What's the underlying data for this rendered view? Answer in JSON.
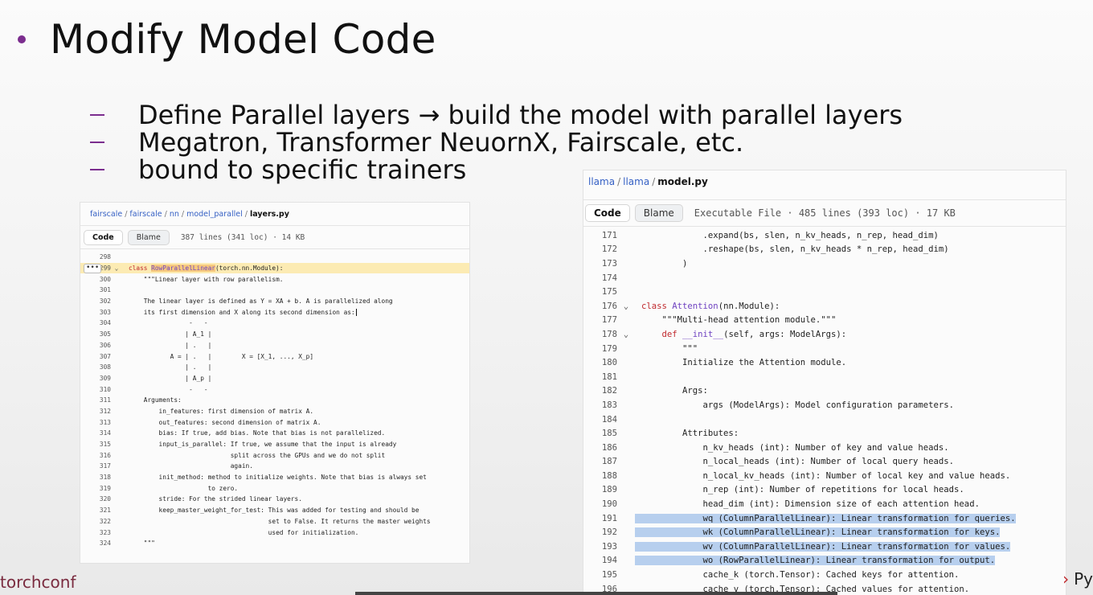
{
  "slide": {
    "title": "Modify Model Code",
    "bullets": [
      "Define Parallel layers → build the model with parallel layers",
      "Megatron, Transformer NeuornX, Fairscale, etc.",
      "bound to specific trainers"
    ],
    "footer_brand": "torchconf",
    "footer_right": "Py",
    "colors": {
      "accent": "#7b2d8e",
      "highlight": "#fcebb3",
      "selection": "#b7cfee"
    }
  },
  "left_panel": {
    "path": [
      "fairscale",
      "fairscale",
      "nn",
      "model_parallel"
    ],
    "file": "layers.py",
    "tabs": {
      "code": "Code",
      "blame": "Blame"
    },
    "file_info": "387 lines (341 loc) · 14 KB",
    "lines": [
      {
        "n": "298",
        "fold": "",
        "t": ""
      },
      {
        "n": "299",
        "fold": "⌄",
        "kw": "class ",
        "name": "RowParallelLinear",
        "rest": "(torch.nn.Module):"
      },
      {
        "n": "300",
        "fold": "",
        "t": "    \"\"\"Linear layer with row parallelism."
      },
      {
        "n": "301",
        "fold": "",
        "t": ""
      },
      {
        "n": "302",
        "fold": "",
        "t": "    The linear layer is defined as Y = XA + b. A is parallelized along"
      },
      {
        "n": "303",
        "fold": "",
        "t": "    its first dimension and X along its second dimension as:"
      },
      {
        "n": "304",
        "fold": "",
        "t": "                -   -"
      },
      {
        "n": "305",
        "fold": "",
        "t": "               | A_1 |"
      },
      {
        "n": "306",
        "fold": "",
        "t": "               | .   |"
      },
      {
        "n": "307",
        "fold": "",
        "t": "           A = | .   |        X = [X_1, ..., X_p]"
      },
      {
        "n": "308",
        "fold": "",
        "t": "               | .   |"
      },
      {
        "n": "309",
        "fold": "",
        "t": "               | A_p |"
      },
      {
        "n": "310",
        "fold": "",
        "t": "                -   -"
      },
      {
        "n": "311",
        "fold": "",
        "t": "    Arguments:"
      },
      {
        "n": "312",
        "fold": "",
        "t": "        in_features: first dimension of matrix A."
      },
      {
        "n": "313",
        "fold": "",
        "t": "        out_features: second dimension of matrix A."
      },
      {
        "n": "314",
        "fold": "",
        "t": "        bias: If true, add bias. Note that bias is not parallelized."
      },
      {
        "n": "315",
        "fold": "",
        "t": "        input_is_parallel: If true, we assume that the input is already"
      },
      {
        "n": "316",
        "fold": "",
        "t": "                           split across the GPUs and we do not split"
      },
      {
        "n": "317",
        "fold": "",
        "t": "                           again."
      },
      {
        "n": "318",
        "fold": "",
        "t": "        init_method: method to initialize weights. Note that bias is always set"
      },
      {
        "n": "319",
        "fold": "",
        "t": "                     to zero."
      },
      {
        "n": "320",
        "fold": "",
        "t": "        stride: For the strided linear layers."
      },
      {
        "n": "321",
        "fold": "",
        "t": "        keep_master_weight_for_test: This was added for testing and should be"
      },
      {
        "n": "322",
        "fold": "",
        "t": "                                     set to False. It returns the master weights"
      },
      {
        "n": "323",
        "fold": "",
        "t": "                                     used for initialization."
      },
      {
        "n": "324",
        "fold": "",
        "t": "    \"\"\""
      }
    ]
  },
  "right_panel": {
    "path": [
      "llama",
      "llama"
    ],
    "file": "model.py",
    "tabs": {
      "code": "Code",
      "blame": "Blame"
    },
    "file_info": "Executable File · 485 lines (393 loc) · 17 KB",
    "lines": [
      {
        "n": "171",
        "fold": "",
        "t": "            .expand(bs, slen, n_kv_heads, n_rep, head_dim)"
      },
      {
        "n": "172",
        "fold": "",
        "t": "            .reshape(bs, slen, n_kv_heads * n_rep, head_dim)"
      },
      {
        "n": "173",
        "fold": "",
        "t": "        )"
      },
      {
        "n": "174",
        "fold": "",
        "t": ""
      },
      {
        "n": "175",
        "fold": "",
        "t": ""
      },
      {
        "n": "176",
        "fold": "⌄",
        "kw": "class ",
        "name": "Attention",
        "rest": "(nn.Module):"
      },
      {
        "n": "177",
        "fold": "",
        "t": "    \"\"\"Multi-head attention module.\"\"\""
      },
      {
        "n": "178",
        "fold": "⌄",
        "kw": "    def ",
        "name": "__init__",
        "rest": "(self, args: ModelArgs):"
      },
      {
        "n": "179",
        "fold": "",
        "t": "        \"\"\""
      },
      {
        "n": "180",
        "fold": "",
        "t": "        Initialize the Attention module."
      },
      {
        "n": "181",
        "fold": "",
        "t": ""
      },
      {
        "n": "182",
        "fold": "",
        "t": "        Args:"
      },
      {
        "n": "183",
        "fold": "",
        "t": "            args (ModelArgs): Model configuration parameters."
      },
      {
        "n": "184",
        "fold": "",
        "t": ""
      },
      {
        "n": "185",
        "fold": "",
        "t": "        Attributes:"
      },
      {
        "n": "186",
        "fold": "",
        "t": "            n_kv_heads (int): Number of key and value heads."
      },
      {
        "n": "187",
        "fold": "",
        "t": "            n_local_heads (int): Number of local query heads."
      },
      {
        "n": "188",
        "fold": "",
        "t": "            n_local_kv_heads (int): Number of local key and value heads."
      },
      {
        "n": "189",
        "fold": "",
        "t": "            n_rep (int): Number of repetitions for local heads."
      },
      {
        "n": "190",
        "fold": "",
        "t": "            head_dim (int): Dimension size of each attention head."
      },
      {
        "n": "191",
        "fold": "",
        "t": "            wq (ColumnParallelLinear): Linear transformation for queries.",
        "sel": true
      },
      {
        "n": "192",
        "fold": "",
        "t": "            wk (ColumnParallelLinear): Linear transformation for keys.",
        "sel": true
      },
      {
        "n": "193",
        "fold": "",
        "t": "            wv (ColumnParallelLinear): Linear transformation for values.",
        "sel": true
      },
      {
        "n": "194",
        "fold": "",
        "t": "            wo (RowParallelLinear): Linear transformation for output.",
        "sel": true
      },
      {
        "n": "195",
        "fold": "",
        "t": "            cache_k (torch.Tensor): Cached keys for attention."
      },
      {
        "n": "196",
        "fold": "",
        "t": "            cache_v (torch.Tensor): Cached values for attention."
      }
    ]
  }
}
